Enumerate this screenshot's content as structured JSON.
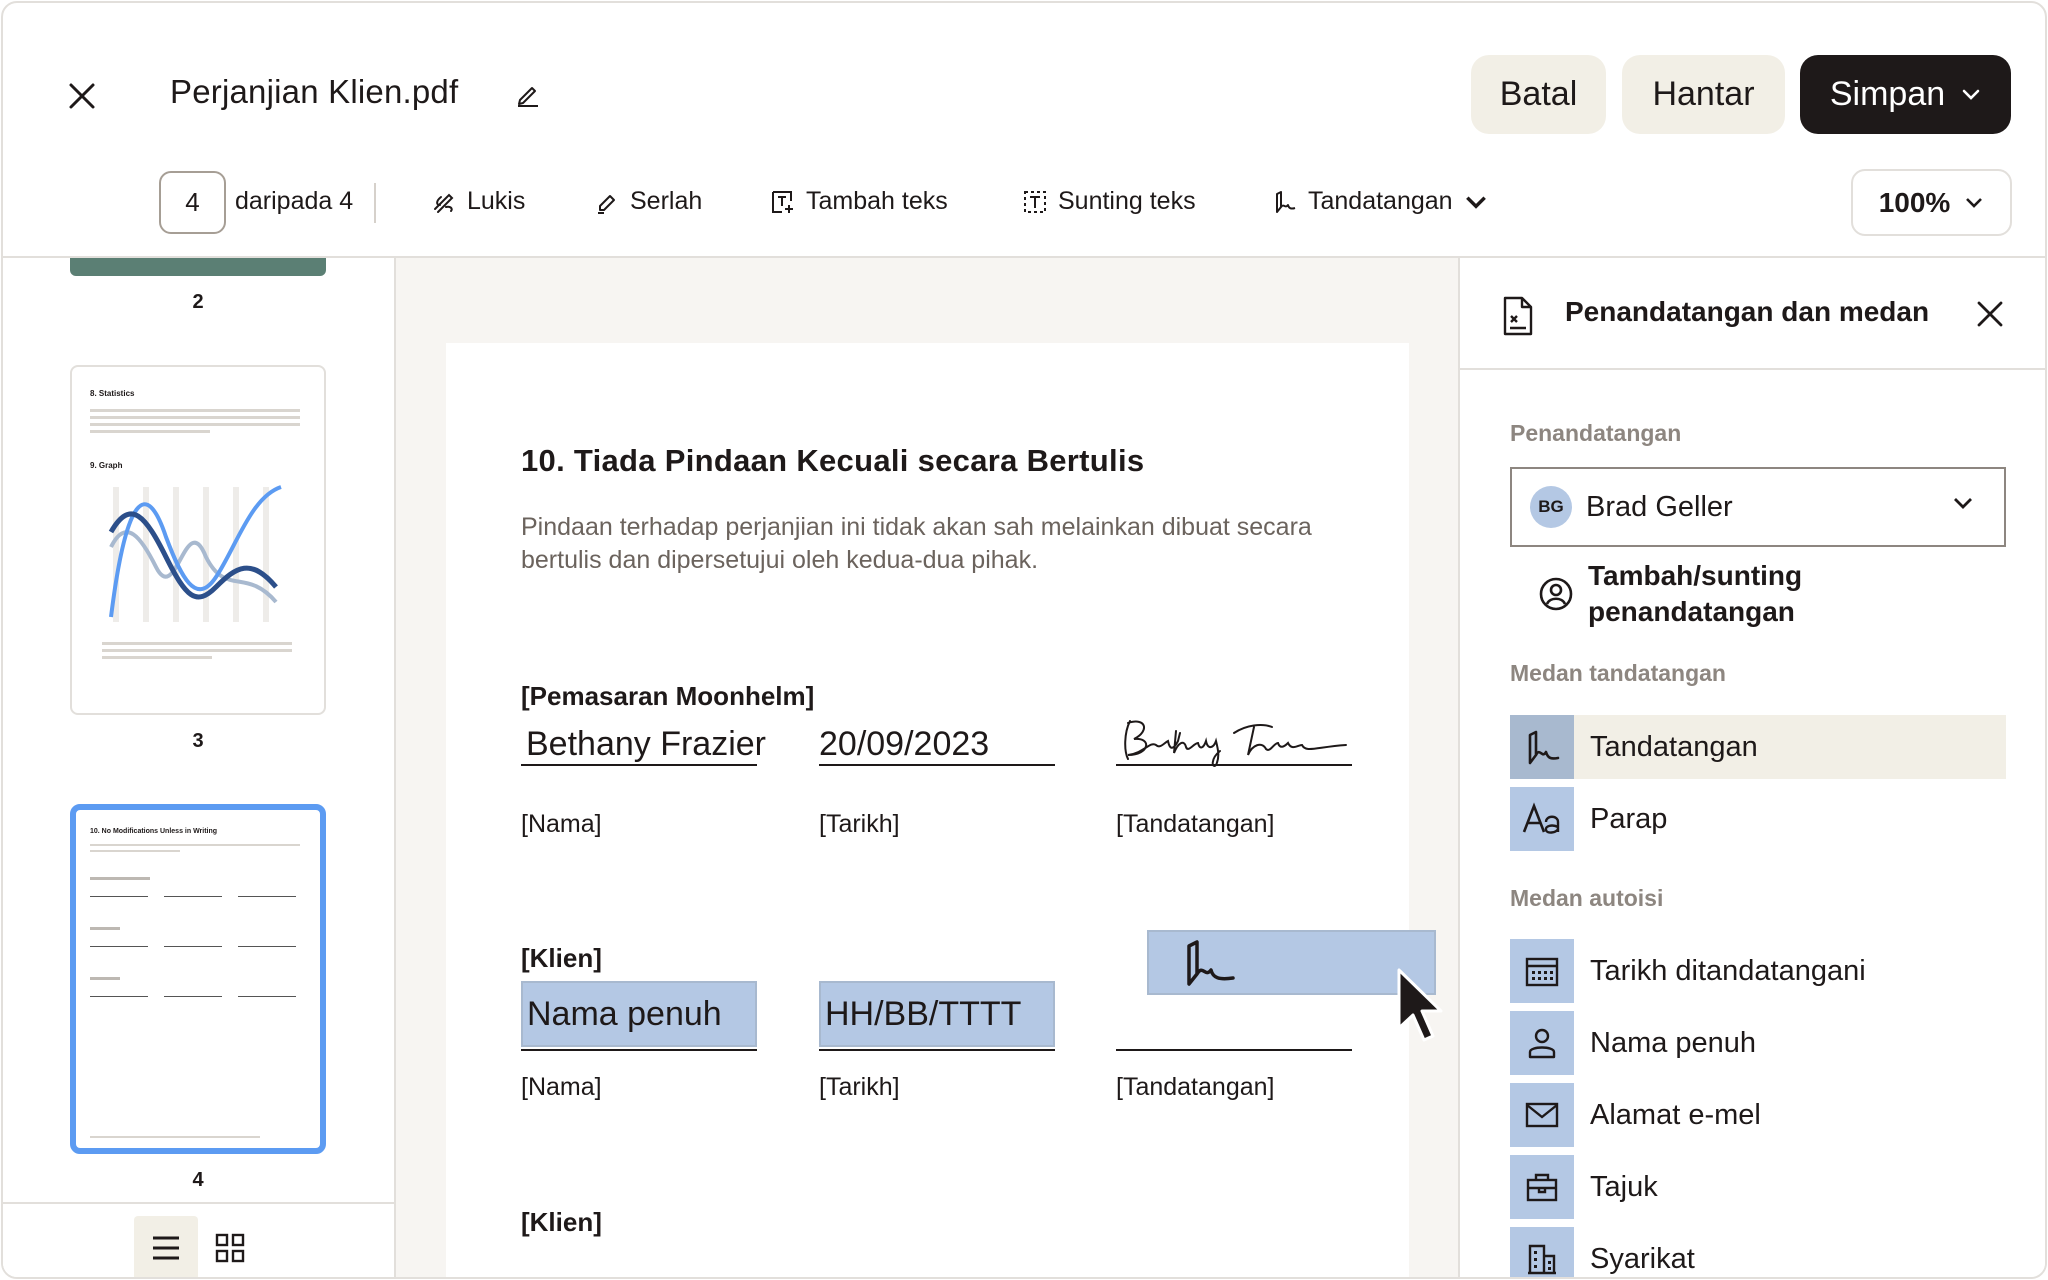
{
  "header": {
    "doc_title": "Perjanjian Klien.pdf",
    "cancel_label": "Batal",
    "send_label": "Hantar",
    "save_label": "Simpan"
  },
  "toolbar": {
    "current_page": "4",
    "page_of": "daripada 4",
    "tools": [
      "Lukis",
      "Serlah",
      "Tambah teks",
      "Sunting teks",
      "Tandatangan"
    ],
    "zoom": "100%"
  },
  "thumbnails": {
    "pages": [
      "2",
      "3",
      "4"
    ],
    "page3_heading1": "8. Statistics",
    "page3_heading2": "9. Graph",
    "page4_heading": "10. No Modifications Unless in Writing"
  },
  "document": {
    "section_title": "10. Tiada Pindaan Kecuali secara Bertulis",
    "section_body": "Pindaan terhadap perjanjian ini tidak akan sah melainkan dibuat secara bertulis dan dipersetujui oleh kedua-dua pihak.",
    "party1": "[Pemasaran Moonhelm]",
    "party1_name": "Bethany Frazier",
    "party1_date": "20/09/2023",
    "party2": "[Klien]",
    "party2_name_field": "Nama penuh",
    "party2_date_field": "HH/BB/TTTT",
    "party3": "[Klien]",
    "label_name": "[Nama]",
    "label_date": "[Tarikh]",
    "label_sig": "[Tandatangan]"
  },
  "panel": {
    "title": "Penandatangan dan medan",
    "signers_heading": "Penandatangan",
    "signer_initials": "BG",
    "signer_name": "Brad Geller",
    "add_signer": "Tambah/sunting penandatangan",
    "sig_fields_heading": "Medan tandatangan",
    "sig_fields": [
      "Tandatangan",
      "Parap"
    ],
    "autofill_heading": "Medan autoisi",
    "autofill_fields": [
      "Tarikh ditandatangani",
      "Nama penuh",
      "Alamat e-mel",
      "Tajuk",
      "Syarikat"
    ]
  },
  "colors": {
    "accent_dark": "#1e1919",
    "soft_button": "#f2efe6",
    "field_blue": "#b4c8e4",
    "selected_thumb": "#5c9bf2"
  }
}
